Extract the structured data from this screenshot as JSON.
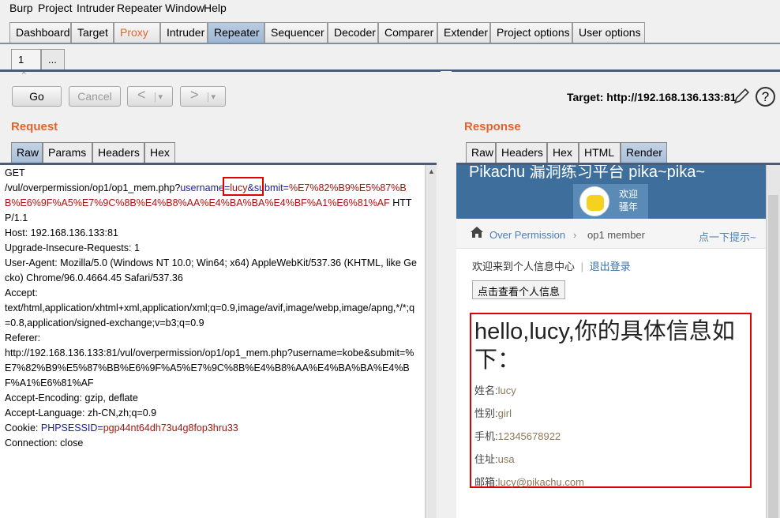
{
  "menu": [
    "Burp",
    "Project",
    "Intruder",
    "Repeater",
    "Window",
    "Help"
  ],
  "tools_tabs": [
    "Dashboard",
    "Target",
    "Proxy",
    "Intruder",
    "Repeater",
    "Sequencer",
    "Decoder",
    "Comparer",
    "Extender",
    "Project options",
    "User options"
  ],
  "active_tool_tab": "Repeater",
  "repeater_tabs": {
    "first": "1",
    "close": "×",
    "more": "..."
  },
  "toolbar": {
    "go": "Go",
    "cancel": "Cancel",
    "back": "<",
    "forward": ">",
    "dropdown": "▾",
    "target_label": "Target: http://192.168.136.133:81",
    "help": "?"
  },
  "request": {
    "title": "Request",
    "tabs": [
      "Raw",
      "Params",
      "Headers",
      "Hex"
    ],
    "lines": {
      "method": "GET",
      "path": "/vul/overpermission/op1/op1_mem.php?",
      "p1_key": "username",
      "eq": "=",
      "p1_val": "lucy",
      "amp": "&",
      "p2_key": "submit",
      "p2_val": "%E7%82%B9%E5%87%BB%E6%9F%A5%E7%9C%8B%E4%B8%AA%E4%BA%BA%E4%BF%A1%E6%81%AF",
      "proto": " HTTP/1.1",
      "host": "Host: 192.168.136.133:81",
      "upgrade": "Upgrade-Insecure-Requests: 1",
      "ua": "User-Agent: Mozilla/5.0 (Windows NT 10.0; Win64; x64) AppleWebKit/537.36 (KHTML, like Gecko) Chrome/96.0.4664.45 Safari/537.36",
      "accept_key": "Accept:",
      "accept_val": "text/html,application/xhtml+xml,application/xml;q=0.9,image/avif,image/webp,image/apng,*/*;q=0.8,application/signed-exchange;v=b3;q=0.9",
      "referer_key": "Referer:",
      "referer_val": "http://192.168.136.133:81/vul/overpermission/op1/op1_mem.php?username=kobe&submit=%E7%82%B9%E5%87%BB%E6%9F%A5%E7%9C%8B%E4%B8%AA%E4%BA%BA%E4%BF%A1%E6%81%AF",
      "enc": "Accept-Encoding: gzip, deflate",
      "lang": "Accept-Language: zh-CN,zh;q=0.9",
      "cookie_key": "Cookie: ",
      "cookie_name": "PHPSESSID",
      "cookie_val": "pgp44nt64dh73u4g8fop3hru33",
      "conn": "Connection: close"
    }
  },
  "response": {
    "title": "Response",
    "tabs": [
      "Raw",
      "Headers",
      "Hex",
      "HTML",
      "Render"
    ],
    "page": {
      "banner_title": "Pikachu 漏洞练习平台 pika~pika~",
      "welcome_1": "欢迎",
      "welcome_2": "骚年",
      "crumb_section": "Over Permission",
      "crumb_sep": "›",
      "crumb_page": "op1 member",
      "hint": "点一下提示~",
      "info_text": "欢迎来到个人信息中心",
      "divider": "|",
      "logout": "退出登录",
      "view_button": "点击查看个人信息",
      "greeting": "hello,lucy,你的具体信息如下：",
      "fields": [
        {
          "label": "姓名:",
          "value": "lucy"
        },
        {
          "label": "性别:",
          "value": "girl"
        },
        {
          "label": "手机:",
          "value": "12345678922"
        },
        {
          "label": "住址:",
          "value": "usa"
        },
        {
          "label": "邮箱:",
          "value": "lucy@pikachu.com"
        }
      ]
    }
  }
}
